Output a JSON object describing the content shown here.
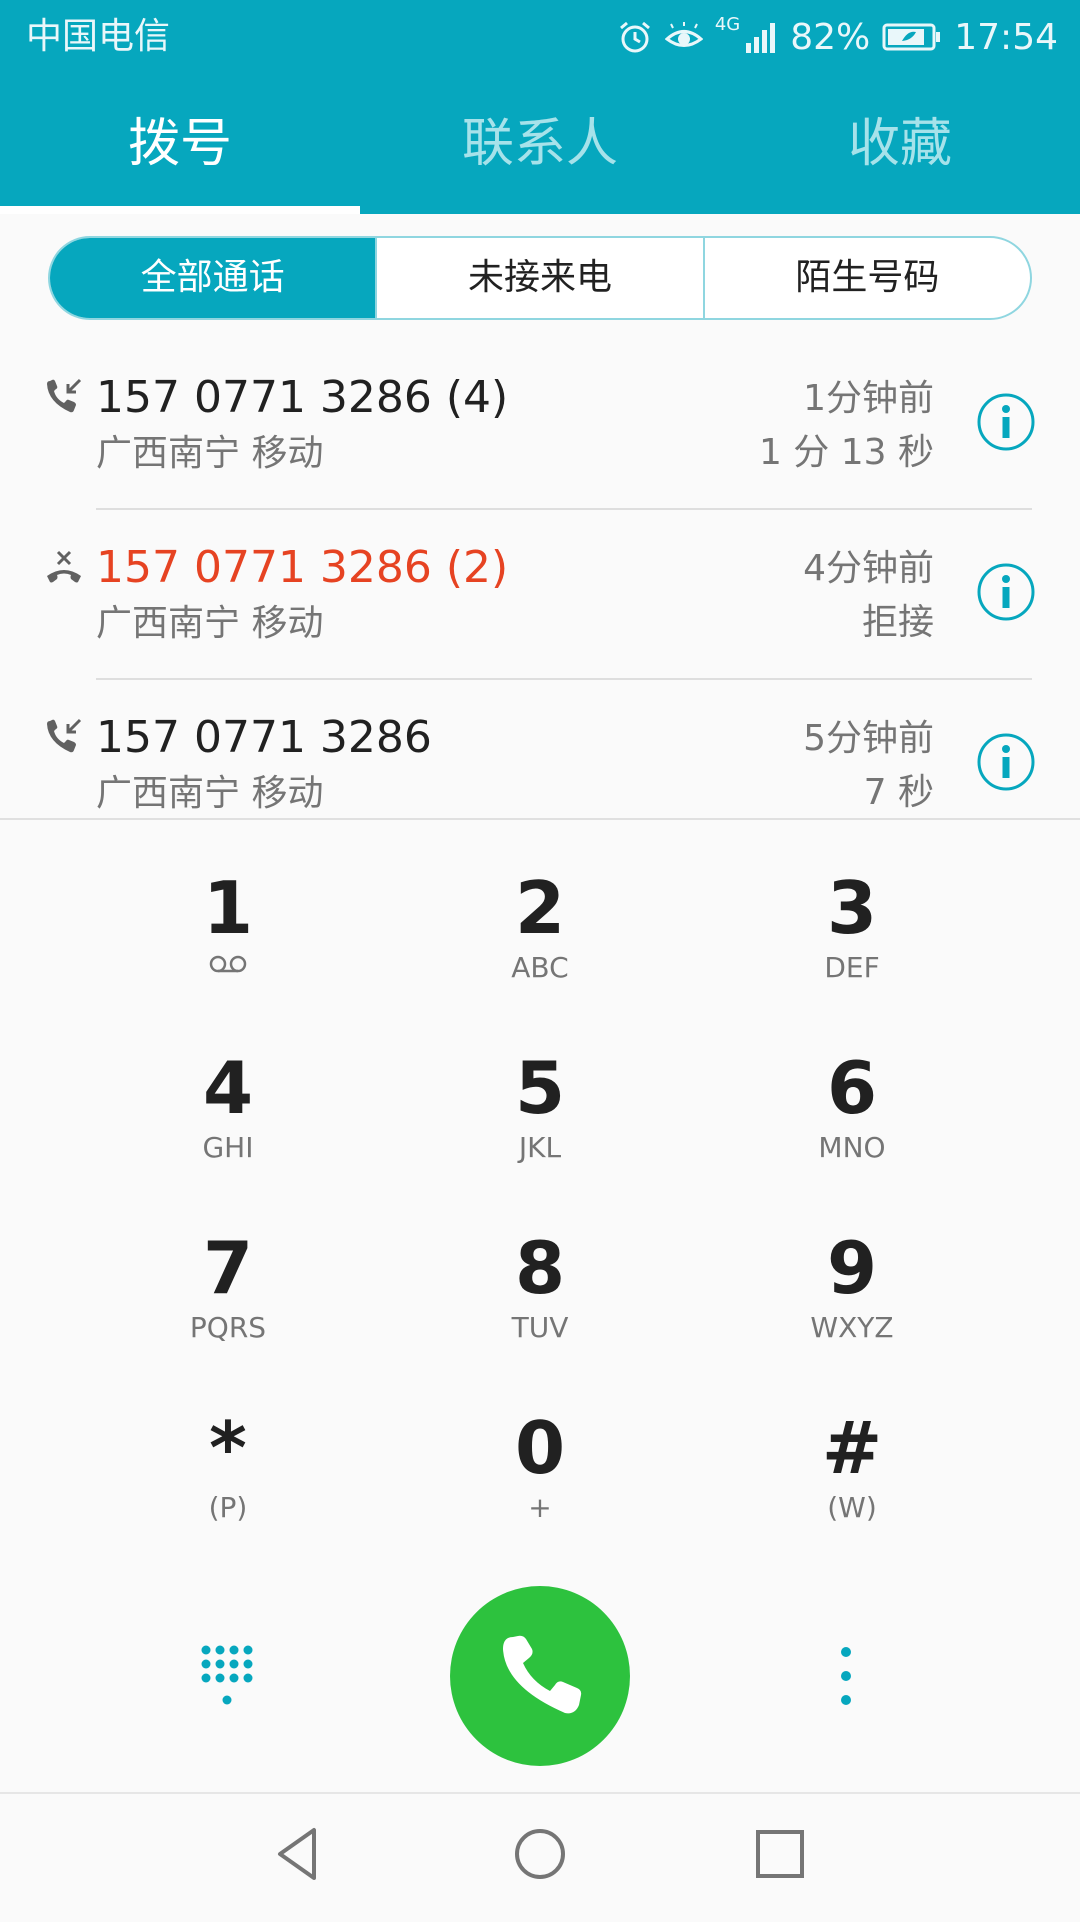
{
  "status_bar": {
    "carrier": "中国电信",
    "network": "4G",
    "battery": "82%",
    "time": "17:54"
  },
  "tabs": [
    {
      "label": "拨号",
      "active": true
    },
    {
      "label": "联系人",
      "active": false
    },
    {
      "label": "收藏",
      "active": false
    }
  ],
  "filters": [
    {
      "label": "全部通话",
      "active": true
    },
    {
      "label": "未接来电",
      "active": false
    },
    {
      "label": "陌生号码",
      "active": false
    }
  ],
  "calls": [
    {
      "type": "incoming",
      "number": "157 0771 3286 (4)",
      "location": "广西南宁 移动",
      "time": "1分钟前",
      "duration": "1 分 13 秒"
    },
    {
      "type": "rejected",
      "number": "157 0771 3286 (2)",
      "location": "广西南宁 移动",
      "time": "4分钟前",
      "duration": "拒接"
    },
    {
      "type": "incoming",
      "number": "157 0771 3286",
      "location": "广西南宁 移动",
      "time": "5分钟前",
      "duration": "7 秒"
    }
  ],
  "keys": [
    {
      "digit": "1",
      "letters": ""
    },
    {
      "digit": "2",
      "letters": "ABC"
    },
    {
      "digit": "3",
      "letters": "DEF"
    },
    {
      "digit": "4",
      "letters": "GHI"
    },
    {
      "digit": "5",
      "letters": "JKL"
    },
    {
      "digit": "6",
      "letters": "MNO"
    },
    {
      "digit": "7",
      "letters": "PQRS"
    },
    {
      "digit": "8",
      "letters": "TUV"
    },
    {
      "digit": "9",
      "letters": "WXYZ"
    },
    {
      "digit": "*",
      "letters": "(P)"
    },
    {
      "digit": "0",
      "letters": "+"
    },
    {
      "digit": "#",
      "letters": "(W)"
    }
  ],
  "colors": {
    "accent": "#06a7be",
    "missed": "#e64322",
    "call_button": "#2dc23e"
  }
}
